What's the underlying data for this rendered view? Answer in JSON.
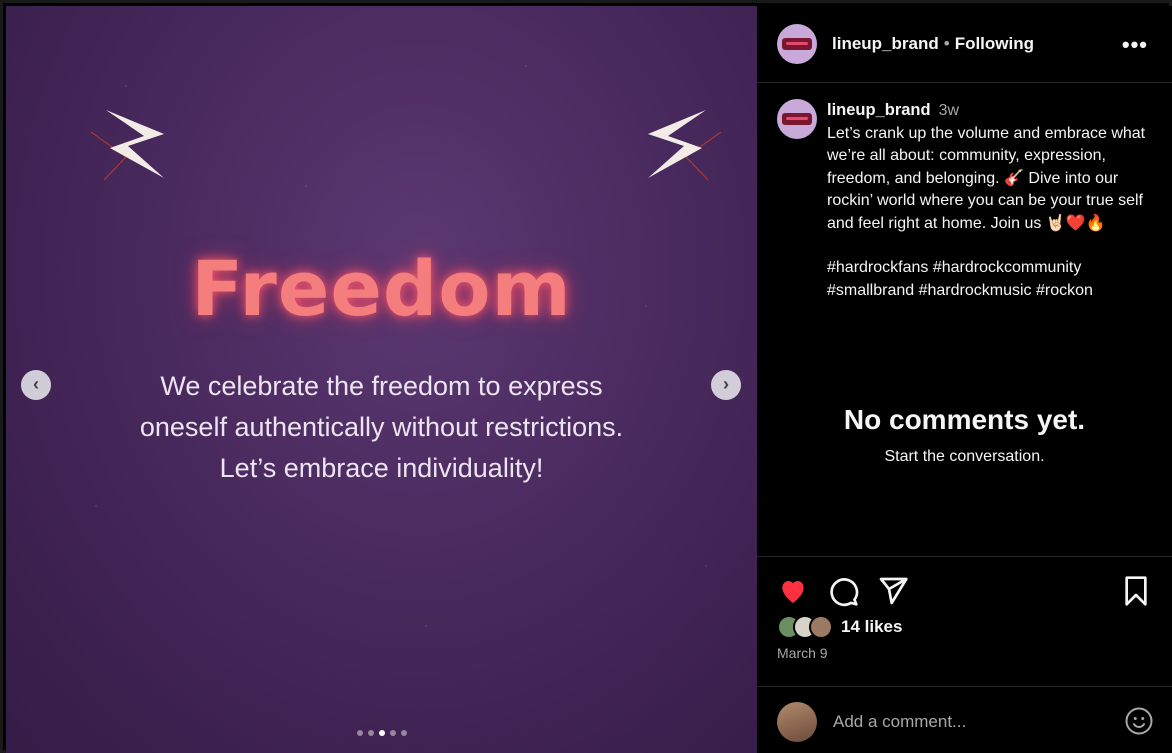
{
  "media": {
    "headline": "Freedom",
    "body_line1": "We celebrate the freedom to express",
    "body_line2": "oneself authentically without restrictions.",
    "body_line3": "Let’s embrace individuality!",
    "prev_icon": "chevron-left-icon",
    "next_icon": "chevron-right-icon",
    "slide_count": 5,
    "active_slide": 3
  },
  "header": {
    "username": "lineup_brand",
    "separator": "•",
    "follow_status": "Following",
    "more_label": "•••"
  },
  "caption": {
    "username": "lineup_brand",
    "time": "3w",
    "text": "Let’s crank up the volume and embrace what we’re all about: community, expression, freedom, and belonging. 🎸 Dive into our rockin’ world where you can be your true self and feel right at home. Join us 🤘🏻❤️🔥",
    "hashtags": "#hardrockfans #hardrockcommunity #smallbrand #hardrockmusic #rockon"
  },
  "comments": {
    "empty_title": "No comments yet.",
    "empty_subtitle": "Start the conversation."
  },
  "actions": {
    "likes": "14 likes",
    "date": "March 9",
    "like_color": "#ff3040"
  },
  "comment_box": {
    "placeholder": "Add a comment..."
  }
}
